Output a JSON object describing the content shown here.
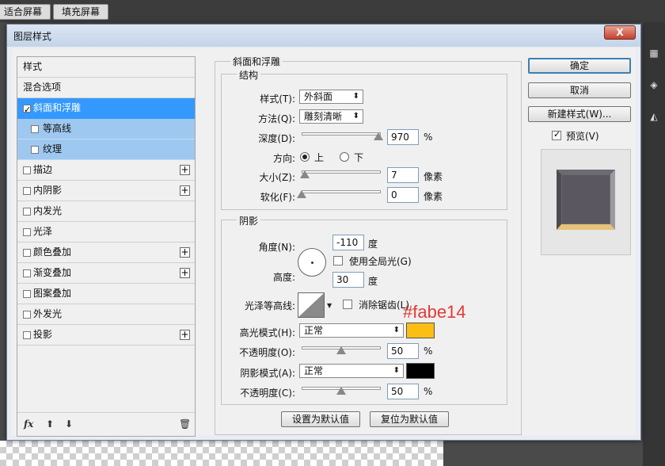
{
  "app": {
    "buttons": [
      "适合屏幕",
      "填充屏幕"
    ]
  },
  "dialog": {
    "title": "图层样式",
    "close_label": "X"
  },
  "style_list": {
    "items": [
      {
        "label": "样式",
        "type": "plain",
        "checked": false,
        "plus": false
      },
      {
        "label": "混合选项",
        "type": "plain",
        "checked": false,
        "plus": false
      },
      {
        "label": "斜面和浮雕",
        "type": "check",
        "checked": true,
        "plus": false,
        "selected": true
      },
      {
        "label": "等高线",
        "type": "sub",
        "checked": false,
        "plus": false
      },
      {
        "label": "纹理",
        "type": "sub",
        "checked": false,
        "plus": false
      },
      {
        "label": "描边",
        "type": "check",
        "checked": false,
        "plus": true
      },
      {
        "label": "内阴影",
        "type": "check",
        "checked": false,
        "plus": true
      },
      {
        "label": "内发光",
        "type": "check",
        "checked": false,
        "plus": false
      },
      {
        "label": "光泽",
        "type": "check",
        "checked": false,
        "plus": false
      },
      {
        "label": "颜色叠加",
        "type": "check",
        "checked": false,
        "plus": true
      },
      {
        "label": "渐变叠加",
        "type": "check",
        "checked": false,
        "plus": true
      },
      {
        "label": "图案叠加",
        "type": "check",
        "checked": false,
        "plus": false
      },
      {
        "label": "外发光",
        "type": "check",
        "checked": false,
        "plus": false
      },
      {
        "label": "投影",
        "type": "check",
        "checked": false,
        "plus": true
      }
    ],
    "footer": {
      "fx_label": "fx"
    }
  },
  "bevel": {
    "group_title": "斜面和浮雕",
    "structure_title": "结构",
    "style_label": "样式(T):",
    "style_value": "外斜面",
    "technique_label": "方法(Q):",
    "technique_value": "雕刻清晰",
    "depth_label": "深度(D):",
    "depth_value": "970",
    "depth_unit": "%",
    "depth_level": 0.97,
    "direction_label": "方向:",
    "direction_up": "上",
    "direction_down": "下",
    "direction_selected": "up",
    "size_label": "大小(Z):",
    "size_value": "7",
    "size_unit": "像素",
    "size_level": 0.035,
    "soften_label": "软化(F):",
    "soften_value": "0",
    "soften_unit": "像素",
    "soften_level": 0
  },
  "shading": {
    "title": "阴影",
    "angle_label": "角度(N):",
    "angle_value": "-110",
    "angle_unit": "度",
    "global_light_label": "使用全局光(G)",
    "global_light_checked": false,
    "altitude_label": "高度:",
    "altitude_value": "30",
    "altitude_unit": "度",
    "gloss_contour_label": "光泽等高线:",
    "antialias_label": "消除锯齿(L)",
    "antialias_checked": false,
    "highlight_mode_label": "高光模式(H):",
    "highlight_mode_value": "正常",
    "highlight_color": "#fabe14",
    "highlight_opacity_label": "不透明度(O):",
    "highlight_opacity_value": "50",
    "highlight_opacity_unit": "%",
    "highlight_opacity_level": 0.5,
    "shadow_mode_label": "阴影模式(A):",
    "shadow_mode_value": "正常",
    "shadow_color": "#000000",
    "shadow_opacity_label": "不透明度(C):",
    "shadow_opacity_value": "50",
    "shadow_opacity_unit": "%",
    "shadow_opacity_level": 0.5
  },
  "annotation": {
    "text": "#fabe14",
    "color": "#e53935"
  },
  "bottom_buttons": {
    "make_default": "设置为默认值",
    "reset_default": "复位为默认值"
  },
  "right_panel": {
    "ok": "确定",
    "cancel": "取消",
    "new_style": "新建样式(W)...",
    "preview_label": "预览(V)",
    "preview_checked": true
  }
}
